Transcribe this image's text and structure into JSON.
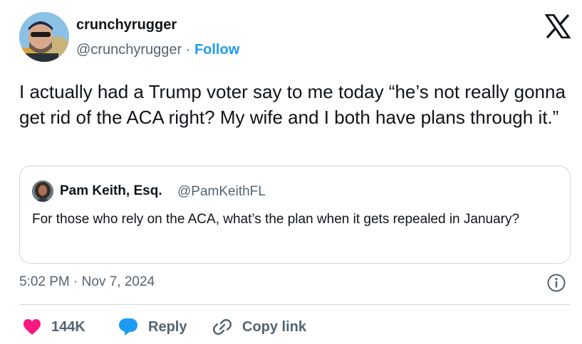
{
  "author": {
    "display_name": "crunchyrugger",
    "handle": "@crunchyrugger",
    "separator": " · ",
    "follow_label": "Follow"
  },
  "platform_icon": "x-logo-icon",
  "tweet": {
    "text": "I actually had a Trump  voter say to me today “he’s not really gonna get rid of the ACA right? My wife and I both have plans through it.”"
  },
  "quoted_tweet": {
    "display_name": "Pam Keith, Esq.",
    "handle": "@PamKeithFL",
    "text": "For those who rely on the ACA, what’s the plan when it gets repealed in January?"
  },
  "timestamp": "5:02 PM · Nov 7, 2024",
  "actions": {
    "like": {
      "icon": "heart-icon",
      "count": "144K"
    },
    "reply": {
      "icon": "speech-bubble-icon",
      "label": "Reply"
    },
    "copy_link": {
      "icon": "link-icon",
      "label": "Copy link"
    }
  },
  "colors": {
    "accent": "#1d9bf0",
    "like": "#f91880",
    "text_primary": "#0f1419",
    "text_secondary": "#536471",
    "border": "#cfd9de"
  }
}
